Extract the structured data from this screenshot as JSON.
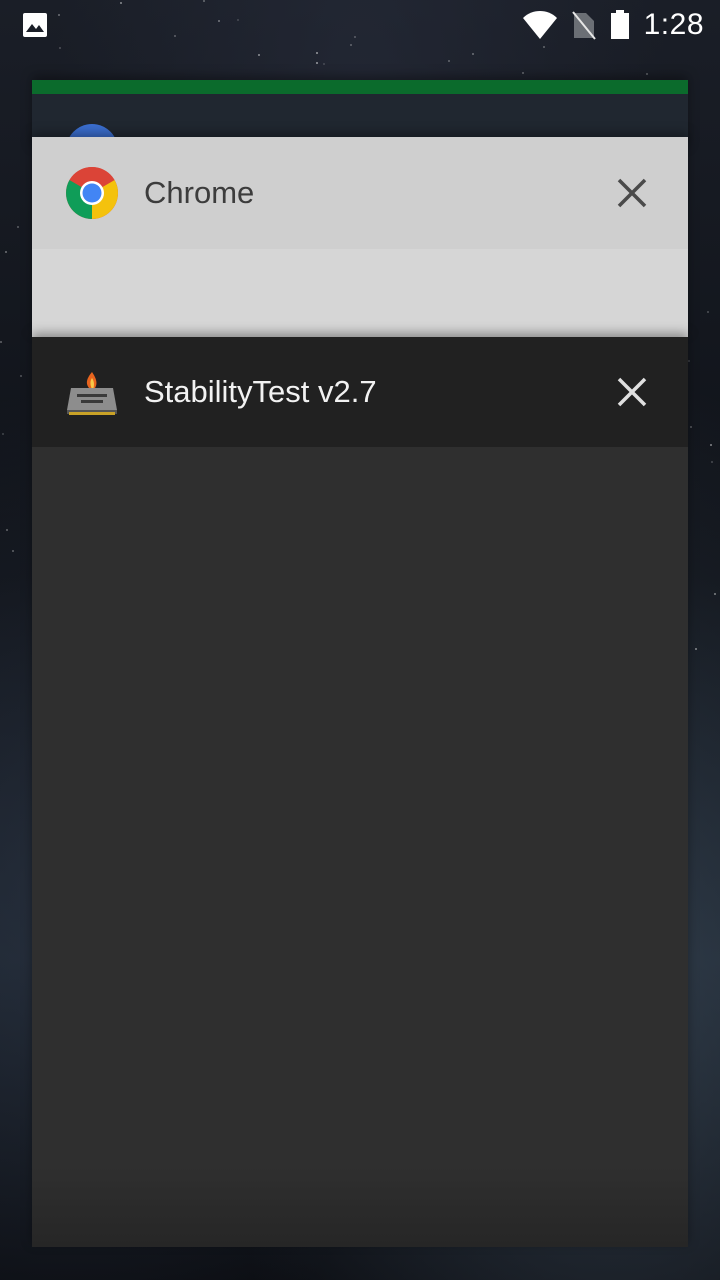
{
  "status_bar": {
    "time": "1:28",
    "left_icon": "image-notification-icon",
    "icons": [
      "wifi-icon",
      "no-sim-icon",
      "battery-icon"
    ]
  },
  "recents": {
    "cards": [
      {
        "app_name": "",
        "accent_color": "#0b6b2c",
        "icon": "partially-hidden-app-icon"
      },
      {
        "app_name": "Chrome",
        "icon": "chrome-icon",
        "header_color": "#cfcfcf"
      },
      {
        "app_name": "StabilityTest v2.7",
        "icon": "stabilitytest-icon",
        "header_color": "#212121"
      }
    ]
  }
}
